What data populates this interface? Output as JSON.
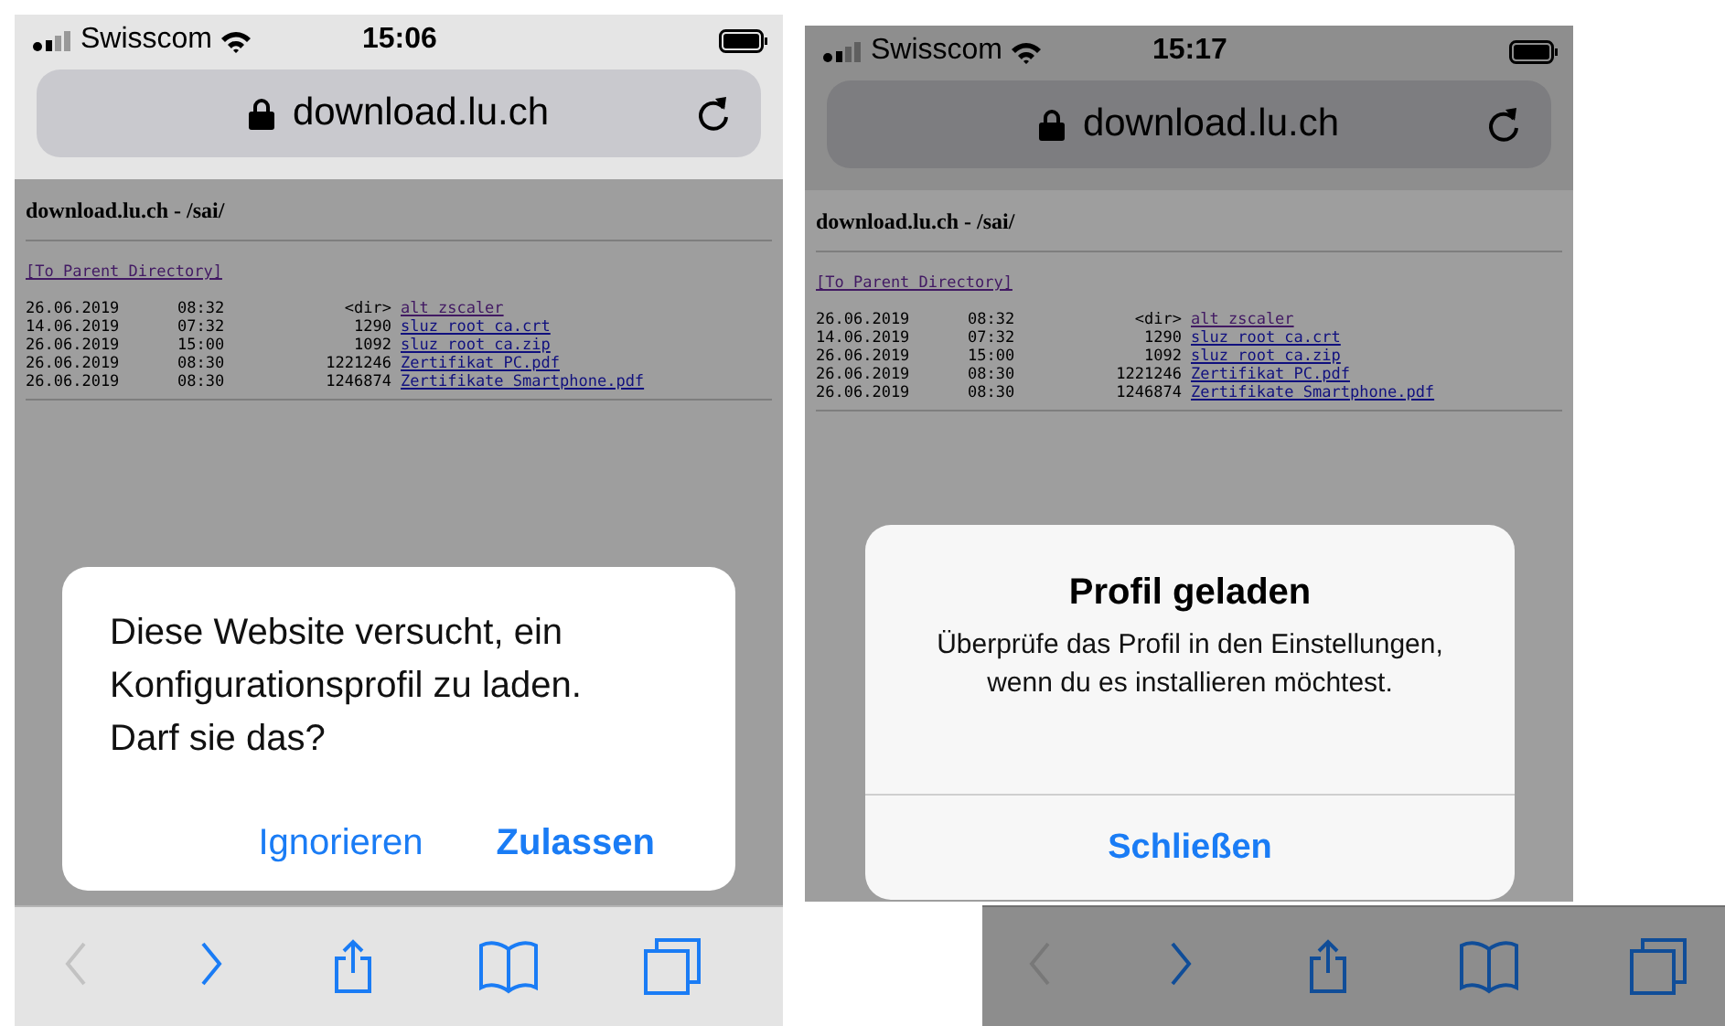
{
  "screens": [
    {
      "chrome_dimmed": false,
      "status_bar": {
        "carrier": "Swisscom",
        "time": "15:06"
      },
      "address_bar": {
        "url": "download.lu.ch"
      },
      "page": {
        "dimmed": true,
        "heading": "download.lu.ch - /sai/",
        "parent_link": {
          "label": "[To Parent Directory]",
          "visited": true
        },
        "entries": [
          {
            "date": "26.06.2019",
            "time": "08:32",
            "size": "<dir>",
            "name": "alt_zscaler",
            "visited": true
          },
          {
            "date": "14.06.2019",
            "time": "07:32",
            "size": "1290",
            "name": "sluz_root_ca.crt",
            "visited": false
          },
          {
            "date": "26.06.2019",
            "time": "15:00",
            "size": "1092",
            "name": "sluz_root_ca.zip",
            "visited": false
          },
          {
            "date": "26.06.2019",
            "time": "08:30",
            "size": "1221246",
            "name": "Zertifikat_PC.pdf",
            "visited": false
          },
          {
            "date": "26.06.2019",
            "time": "08:30",
            "size": "1246874",
            "name": "Zertifikate_Smartphone.pdf",
            "visited": false
          }
        ]
      },
      "dialog": {
        "kind": "prompt",
        "message": "Diese Website versucht, ein Konfigurationsprofil zu laden. Darf sie das?",
        "buttons": [
          {
            "label": "Ignorieren",
            "primary": false
          },
          {
            "label": "Zulassen",
            "primary": true
          }
        ]
      }
    },
    {
      "chrome_dimmed": true,
      "status_bar": {
        "carrier": "Swisscom",
        "time": "15:17"
      },
      "address_bar": {
        "url": "download.lu.ch"
      },
      "page": {
        "dimmed": true,
        "heading": "download.lu.ch - /sai/",
        "parent_link": {
          "label": "[To Parent Directory]",
          "visited": true
        },
        "entries": [
          {
            "date": "26.06.2019",
            "time": "08:32",
            "size": "<dir>",
            "name": "alt_zscaler",
            "visited": true
          },
          {
            "date": "14.06.2019",
            "time": "07:32",
            "size": "1290",
            "name": "sluz_root_ca.crt",
            "visited": false
          },
          {
            "date": "26.06.2019",
            "time": "15:00",
            "size": "1092",
            "name": "sluz_root_ca.zip",
            "visited": false
          },
          {
            "date": "26.06.2019",
            "time": "08:30",
            "size": "1221246",
            "name": "Zertifikat_PC.pdf",
            "visited": false
          },
          {
            "date": "26.06.2019",
            "time": "08:30",
            "size": "1246874",
            "name": "Zertifikate_Smartphone.pdf",
            "visited": false
          }
        ]
      },
      "dialog": {
        "kind": "alert",
        "title": "Profil geladen",
        "message": "Überprüfe das Profil in den Einstellungen, wenn du es installieren möchtest.",
        "buttons": [
          {
            "label": "Schließen",
            "primary": true
          }
        ]
      }
    }
  ],
  "toolbars": [
    {
      "dimmed": false,
      "buttons": [
        {
          "kind": "back",
          "disabled": true
        },
        {
          "kind": "forward",
          "disabled": false
        },
        {
          "kind": "share",
          "disabled": false
        },
        {
          "kind": "bookmarks",
          "disabled": false
        },
        {
          "kind": "tabs",
          "disabled": false
        }
      ]
    },
    {
      "dimmed": true,
      "buttons": [
        {
          "kind": "back",
          "disabled": true
        },
        {
          "kind": "forward",
          "disabled": false
        },
        {
          "kind": "share",
          "disabled": false
        },
        {
          "kind": "bookmarks",
          "disabled": false
        },
        {
          "kind": "tabs",
          "disabled": false
        }
      ]
    }
  ]
}
